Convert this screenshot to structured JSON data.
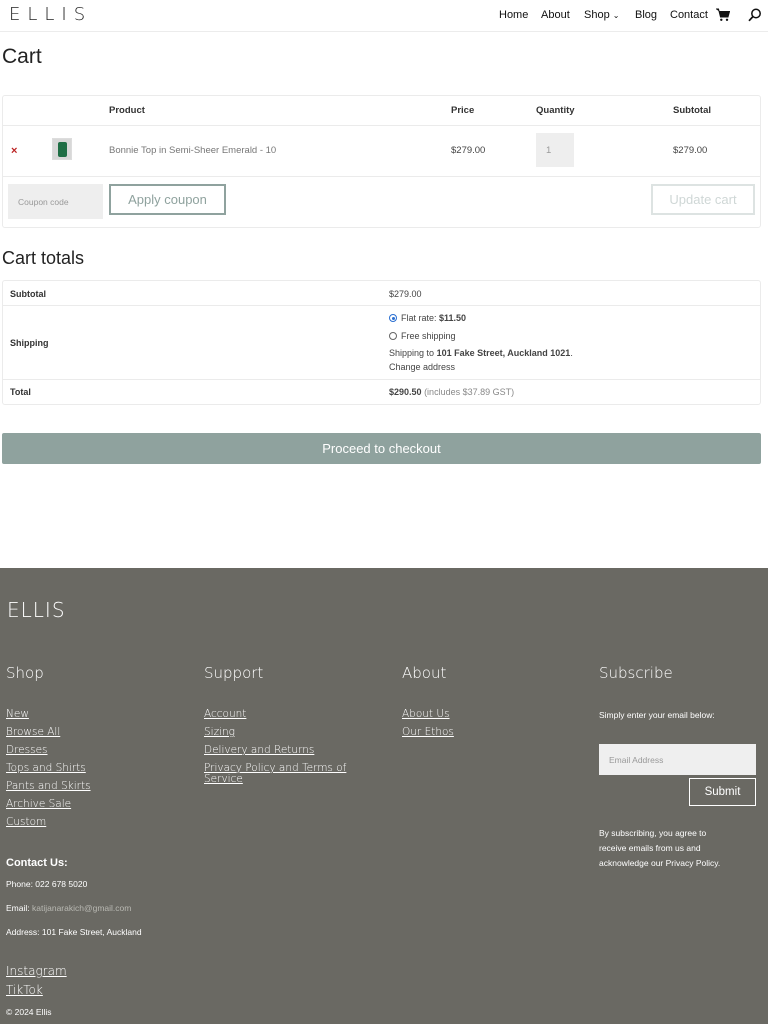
{
  "header": {
    "logo": "ELLIS",
    "nav": {
      "home": "Home",
      "about": "About",
      "shop": "Shop",
      "blog": "Blog",
      "contact": "Contact"
    }
  },
  "cart": {
    "title": "Cart",
    "columns": {
      "product": "Product",
      "price": "Price",
      "quantity": "Quantity",
      "subtotal": "Subtotal"
    },
    "items": [
      {
        "remove": "×",
        "name": "Bonnie Top in Semi-Sheer Emerald - 10",
        "price": "$279.00",
        "quantity": "1",
        "subtotal": "$279.00"
      }
    ],
    "coupon_placeholder": "Coupon code",
    "apply_coupon": "Apply coupon",
    "update_cart": "Update cart"
  },
  "totals": {
    "title": "Cart totals",
    "subtotal_label": "Subtotal",
    "subtotal_value": "$279.00",
    "shipping_label": "Shipping",
    "flat_rate_label": "Flat rate:",
    "flat_rate_value": "$11.50",
    "free_shipping": "Free shipping",
    "shipping_to_prefix": "Shipping to",
    "shipping_address": "101 Fake Street, Auckland 1021",
    "shipping_to_suffix": ".",
    "change_address": "Change address",
    "total_label": "Total",
    "total_value": "$290.50",
    "total_note": "(includes $37.89 GST)",
    "checkout": "Proceed to checkout"
  },
  "footer": {
    "logo": "ELLIS",
    "shop": {
      "heading": "Shop",
      "links": [
        "New",
        "Browse All",
        "Dresses",
        "Tops and Shirts",
        "Pants and Skirts",
        "Archive Sale",
        "Custom"
      ]
    },
    "support": {
      "heading": "Support",
      "links": [
        "Account",
        "Sizing",
        "Delivery and Returns",
        "Privacy Policy and Terms of",
        "Service"
      ]
    },
    "about": {
      "heading": "About",
      "links": [
        "About Us",
        "Our Ethos"
      ]
    },
    "subscribe": {
      "heading": "Subscribe",
      "prompt": "Simply enter your email below:",
      "email_placeholder": "Email Address",
      "submit": "Submit",
      "disclaimer": [
        "By subscribing, you agree to",
        "receive emails from us and",
        "acknowledge our Privacy Policy."
      ]
    },
    "contact": {
      "heading": "Contact Us:",
      "phone": "Phone: 022 678 5020",
      "email_label": "Email:",
      "email": "katijanarakich@gmail.com",
      "address": "Address: 101 Fake Street, Auckland"
    },
    "social": [
      "Instagram",
      "TikTok"
    ],
    "copyright": "© 2024 Ellis"
  },
  "colors": {
    "accent": "#8fa29e",
    "footer_bg": "#6a6963",
    "remove": "#bb2222"
  },
  "icons": [
    "cart-icon",
    "search-icon",
    "chevron-down-icon",
    "remove-icon"
  ]
}
